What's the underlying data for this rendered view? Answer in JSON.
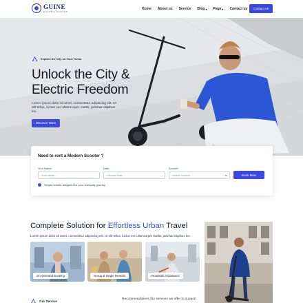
{
  "nav": {
    "logo_name": "GUINE",
    "logo_sub": "ELECTRIC SCOOTER",
    "menu": [
      {
        "label": "Home",
        "has_caret": false
      },
      {
        "label": "About us",
        "has_caret": false
      },
      {
        "label": "Service",
        "has_caret": false
      },
      {
        "label": "Blog",
        "has_caret": true
      },
      {
        "label": "Page",
        "has_caret": true
      },
      {
        "label": "Contact us",
        "has_caret": false
      }
    ],
    "contact_button": "Contact us"
  },
  "hero": {
    "eyebrow": "Explore the City on Your Terms",
    "title_line1": "Unlock the City &",
    "title_line2": "Electric Freedom",
    "description": "Lorem ipsum dolor sit amet, consectetur adipiscing elit. Ut elit tellus, luctus nec ullamcorper mattis, pulvinar dapibus leo.",
    "cta": "Discover More"
  },
  "booking": {
    "title": "Need to rent a Modern Scooter ?",
    "fields": [
      {
        "label": "Your Name",
        "placeholder": "Your name ..."
      },
      {
        "label": "Date",
        "placeholder": "Choose Date"
      },
      {
        "label": "Scooter",
        "placeholder": "Select Scooter"
      }
    ],
    "book_button": "Book Now",
    "note": "Simple rentals designed for your everyday journey"
  },
  "solution": {
    "title_start": "Complete Solution for ",
    "title_accent": "Effortless Urban",
    "title_end": " Travel",
    "description": "Lorem ipsum dolor sit amet, consectetur adipiscing elit. Ut elit tellus, luctus nec ullamcorper mattis, pulvinar dapibus leo.",
    "cards": [
      {
        "label": "On-Demand Booking"
      },
      {
        "label": "Group & Single Rentals"
      },
      {
        "label": "Roadside Assistance"
      }
    ]
  },
  "services": {
    "eyebrow": "Our Service",
    "recommend": "Recommendations the services we offer to support"
  },
  "colors": {
    "accent": "#3b49df"
  }
}
